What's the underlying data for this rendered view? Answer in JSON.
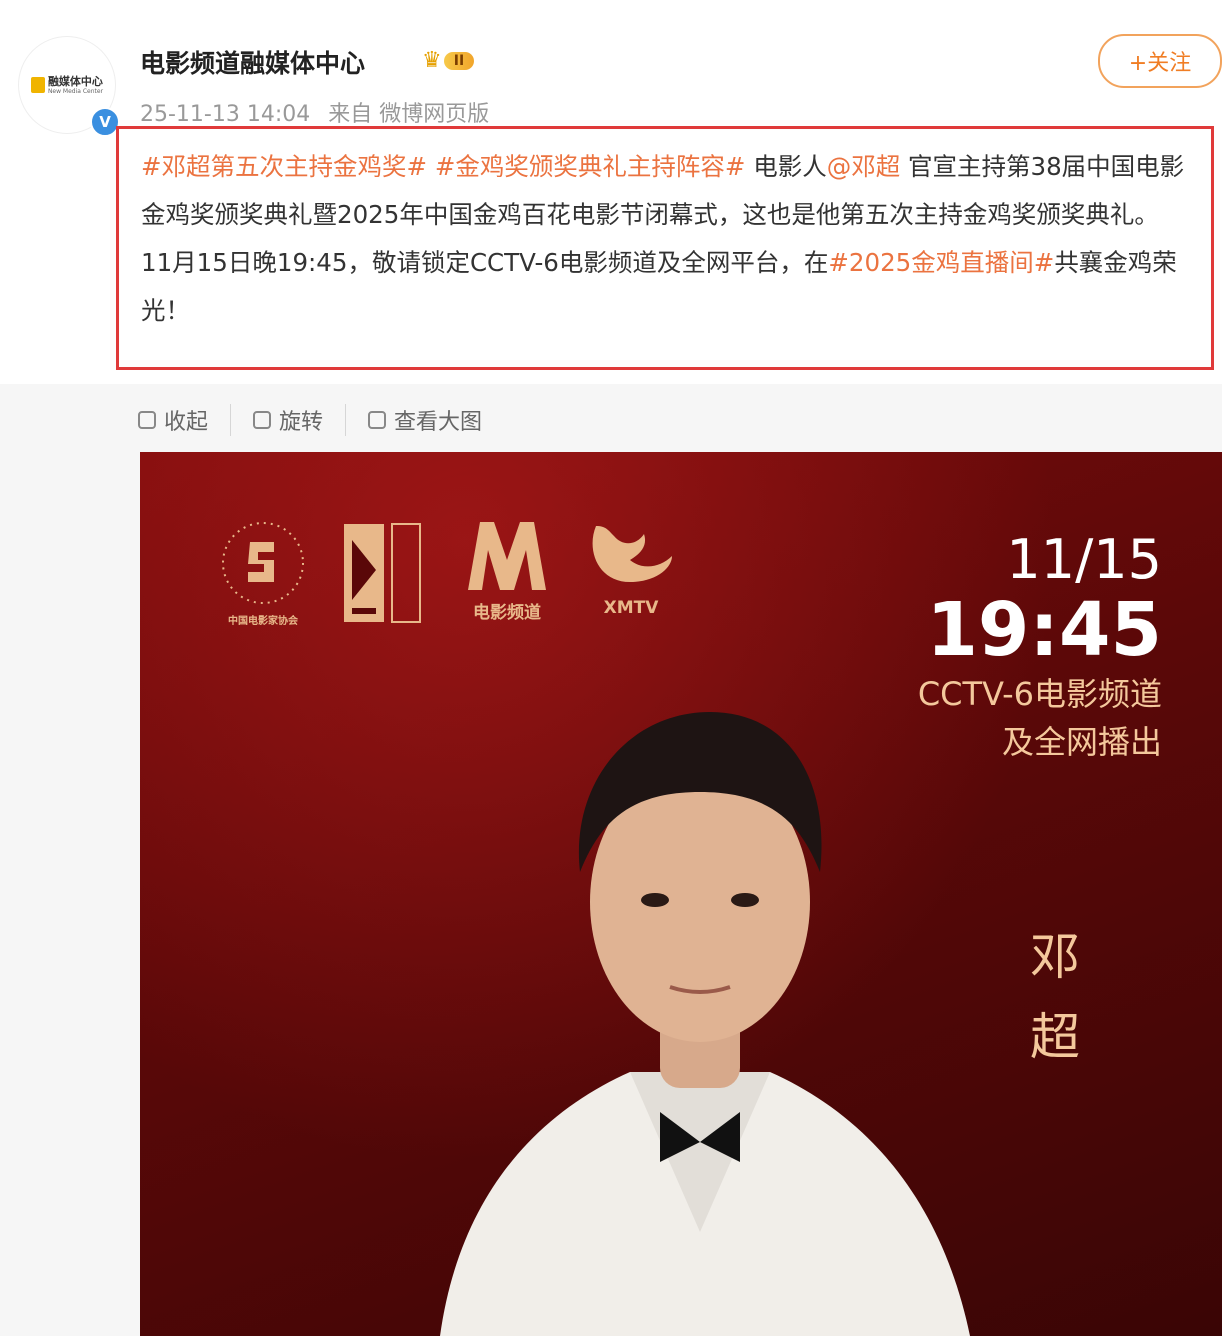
{
  "post": {
    "author": "电影频道融媒体中心",
    "avatar_text": "融媒体中心",
    "avatar_sub": "New Media Center",
    "level": "II",
    "follow_label": "+关注",
    "time": "25-11-13 14:04",
    "source": "来自 微博网页版",
    "content": [
      {
        "type": "tag",
        "text": "#邓超第五次主持金鸡奖#"
      },
      {
        "type": "text",
        "text": " "
      },
      {
        "type": "tag",
        "text": "#金鸡奖颁奖典礼主持阵容#"
      },
      {
        "type": "text",
        "text": " 电影人"
      },
      {
        "type": "tag",
        "text": "@邓超"
      },
      {
        "type": "text",
        "text": " 官宣主持第38届中国电影金鸡奖颁奖典礼暨2025年中国金鸡百花电影节闭幕式，这也是他第五次主持金鸡奖颁奖典礼。"
      },
      {
        "type": "br"
      },
      {
        "type": "text",
        "text": "11月15日晚19:45，敬请锁定CCTV-6电影频道及全网平台，在"
      },
      {
        "type": "tag",
        "text": "#2025金鸡直播间#"
      },
      {
        "type": "text",
        "text": "共襄金鸡荣光！"
      }
    ]
  },
  "toolbar": {
    "collapse": "收起",
    "rotate": "旋转",
    "view_large": "查看大图"
  },
  "poster": {
    "logo1_caption": "中国电影家协会",
    "logo3_caption": "电影频道",
    "logo4_caption": "XMTV",
    "date": "11/15",
    "time": "19:45",
    "channel": "CCTV-6电影频道",
    "broadcast": "及全网播出",
    "name": "邓超"
  },
  "colors": {
    "tag": "#eb7340",
    "highlight_border": "#e03a3a",
    "follow": "#f07d24",
    "poster_gold": "#f4c89c"
  }
}
